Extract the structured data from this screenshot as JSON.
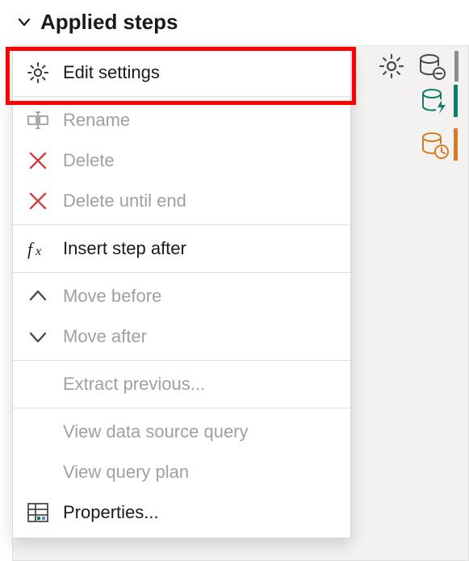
{
  "header": {
    "title": "Applied steps"
  },
  "step_row": {
    "icon_name": "table-icon",
    "icon_color": "#d67b27"
  },
  "toolbar": {
    "gear_icon": "gear-icon",
    "db_minus_icon": "database-remove-icon"
  },
  "side_icons": [
    {
      "name": "database-lightning-icon",
      "bar_color": "#0d7d6c"
    },
    {
      "name": "database-clock-icon",
      "bar_color": "#d67b27"
    }
  ],
  "context_menu": {
    "items": [
      {
        "id": "edit-settings",
        "label": "Edit settings",
        "icon": "gear-icon",
        "enabled": true,
        "divider_after": true
      },
      {
        "id": "rename",
        "label": "Rename",
        "icon": "rename-icon",
        "enabled": false
      },
      {
        "id": "delete",
        "label": "Delete",
        "icon": "x-icon",
        "enabled": false
      },
      {
        "id": "delete-until-end",
        "label": "Delete until end",
        "icon": "x-icon",
        "enabled": false,
        "divider_after": true
      },
      {
        "id": "insert-step-after",
        "label": "Insert step after",
        "icon": "fx-icon",
        "enabled": true,
        "divider_after": true
      },
      {
        "id": "move-before",
        "label": "Move before",
        "icon": "chevron-up-icon",
        "enabled": false
      },
      {
        "id": "move-after",
        "label": "Move after",
        "icon": "chevron-down-icon",
        "enabled": false,
        "divider_after": true
      },
      {
        "id": "extract-previous",
        "label": "Extract previous...",
        "icon": null,
        "enabled": false,
        "divider_after": true
      },
      {
        "id": "view-data-source-query",
        "label": "View data source query",
        "icon": null,
        "enabled": false
      },
      {
        "id": "view-query-plan",
        "label": "View query plan",
        "icon": null,
        "enabled": false
      },
      {
        "id": "properties",
        "label": "Properties...",
        "icon": "table-properties-icon",
        "enabled": true
      }
    ]
  }
}
